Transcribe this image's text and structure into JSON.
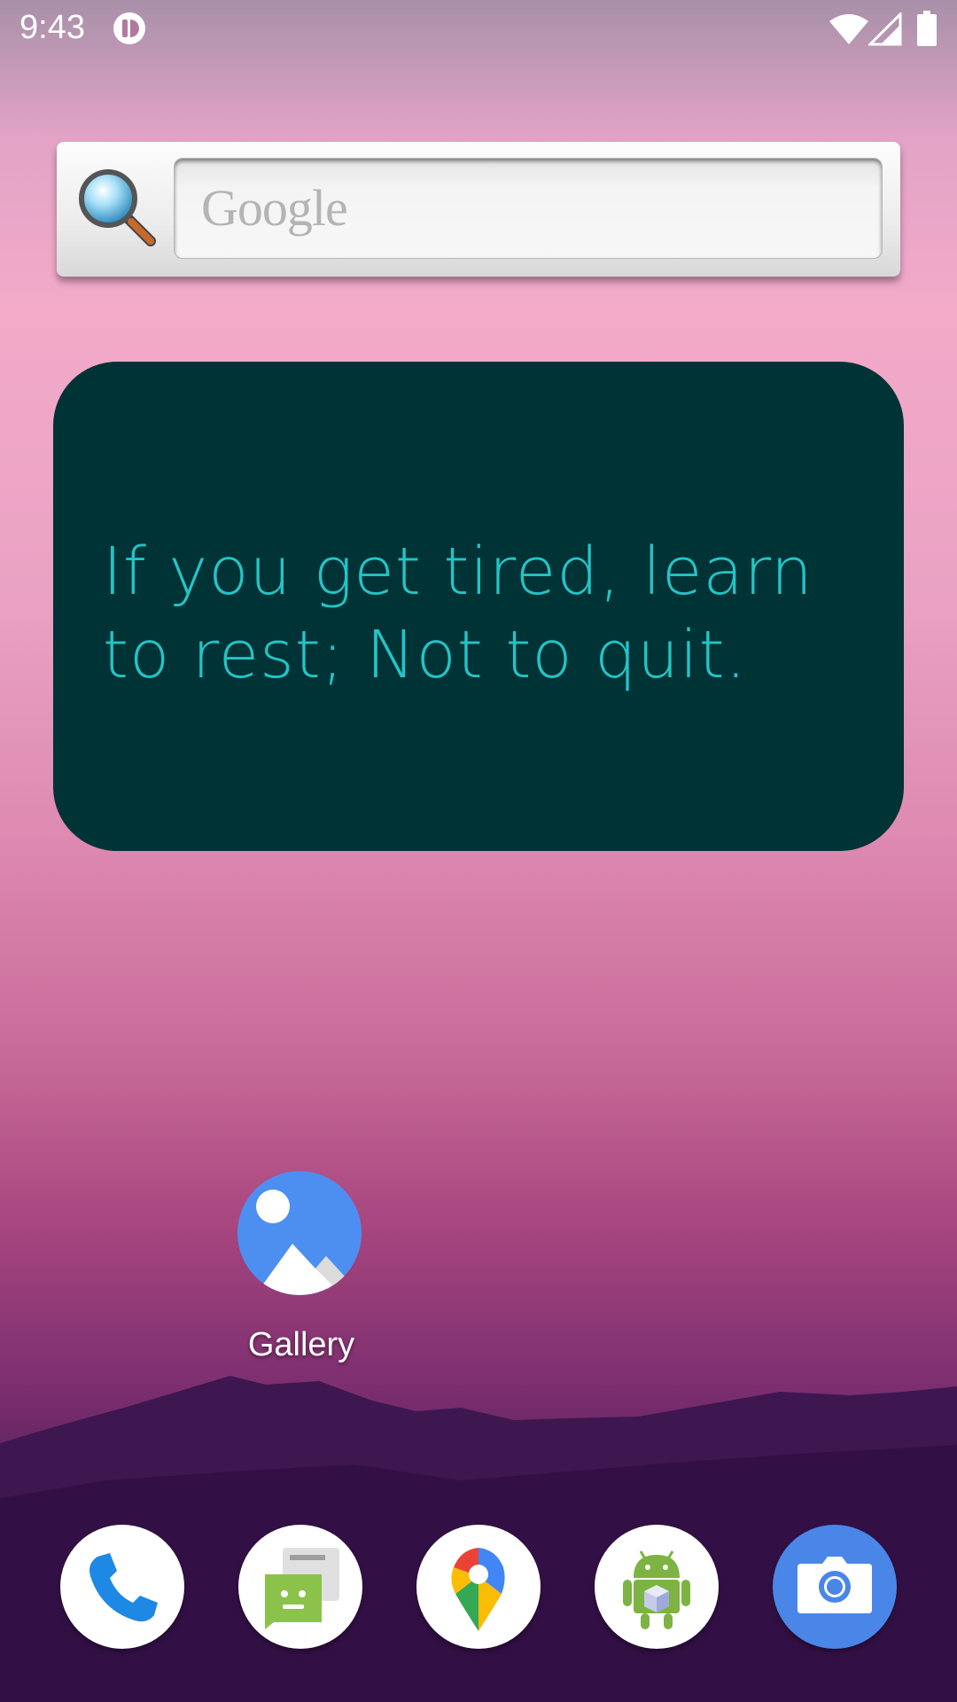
{
  "status_bar": {
    "time": "9:43",
    "icons": [
      "notification-icon",
      "wifi-icon",
      "signal-icon",
      "battery-icon"
    ]
  },
  "search_widget": {
    "placeholder": "Google",
    "icon": "magnifier-icon"
  },
  "quote_widget": {
    "text": "If you get tired, learn to rest; Not to quit.",
    "background": "#003336",
    "text_color": "#23c4c6"
  },
  "home_apps": [
    {
      "label": "Gallery",
      "icon": "gallery-icon"
    }
  ],
  "dock": [
    {
      "icon": "phone-icon"
    },
    {
      "icon": "messages-icon"
    },
    {
      "icon": "maps-icon"
    },
    {
      "icon": "android-icon"
    },
    {
      "icon": "camera-icon"
    }
  ]
}
